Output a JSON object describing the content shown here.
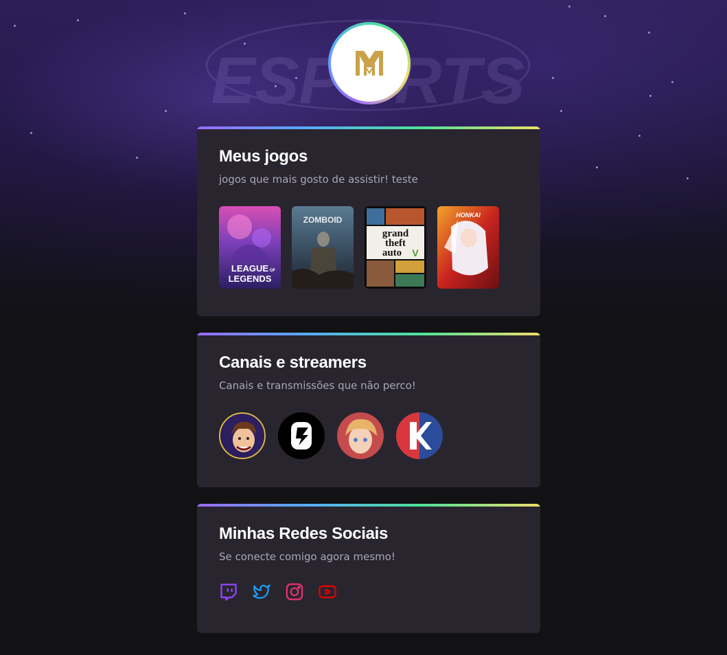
{
  "profile": {
    "logo_letter": "M",
    "colors": {
      "logo_gold": "#c9a24a",
      "ring": [
        "#9a6cff",
        "#57a8ff",
        "#4de39a",
        "#f0df6a"
      ]
    }
  },
  "hero": {
    "watermark_text": "ESPORTS"
  },
  "games_section": {
    "title": "Meus jogos",
    "subtitle": "jogos que mais gosto de assistir! teste",
    "games": [
      {
        "name": "League of Legends",
        "cover_line1": "LEAGUE",
        "cover_of": "OF",
        "cover_line2": "LEGENDS"
      },
      {
        "name": "Project Zomboid",
        "cover_text": "ZOMBOID"
      },
      {
        "name": "Grand Theft Auto V",
        "cover_line1": "grand",
        "cover_line2": "theft",
        "cover_line3": "auto"
      },
      {
        "name": "Honkai Impact 3rd",
        "cover_text": "HONKAI"
      }
    ]
  },
  "channels_section": {
    "title": "Canais e streamers",
    "subtitle": "Canais e transmissões que não perco!",
    "channels": [
      {
        "name": "streamer-cartoon-avatar"
      },
      {
        "name": "streamer-c-logo"
      },
      {
        "name": "streamer-anime-avatar"
      },
      {
        "name": "streamer-k-logo"
      }
    ]
  },
  "socials_section": {
    "title": "Minhas Redes Sociais",
    "subtitle": "Se conecte comigo agora mesmo!",
    "links": [
      {
        "icon": "twitch-icon",
        "color": "#9147ff"
      },
      {
        "icon": "twitter-icon",
        "color": "#1d9bf0"
      },
      {
        "icon": "instagram-icon",
        "color": "#e1306c"
      },
      {
        "icon": "youtube-icon",
        "color": "#e00000"
      }
    ]
  }
}
